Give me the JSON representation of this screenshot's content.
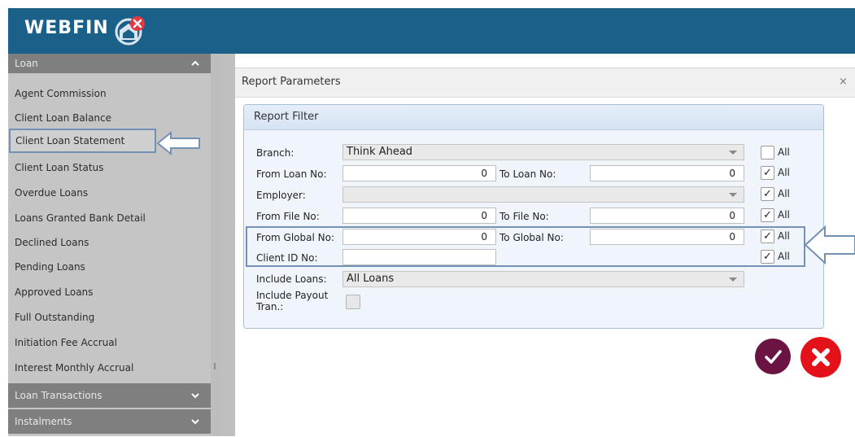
{
  "app": {
    "title": "WEBFIN",
    "logo_icon": "logo-icon"
  },
  "colors": {
    "header": "#1b6088",
    "sidebar": "#c5c5c5",
    "section": "#7f7f7f",
    "ok": "#6b1443",
    "cancel": "#e3111a"
  },
  "sidebar": {
    "loan_section": "Loan",
    "items": [
      {
        "label": "Agent Commission"
      },
      {
        "label": "Client Loan Balance"
      },
      {
        "label": "Client Loan Statement"
      },
      {
        "label": "Client Loan Status"
      },
      {
        "label": "Overdue Loans"
      },
      {
        "label": "Loans Granted Bank Detail"
      },
      {
        "label": "Declined Loans"
      },
      {
        "label": "Pending Loans"
      },
      {
        "label": "Approved Loans"
      },
      {
        "label": "Full Outstanding"
      },
      {
        "label": "Initiation Fee Accrual"
      },
      {
        "label": "Interest Monthly Accrual"
      }
    ],
    "transactions_section": "Loan Transactions",
    "instalments_section": "Instalments"
  },
  "dialog": {
    "title": "Report Parameters",
    "close": "×",
    "filter": {
      "title": "Report Filter",
      "branch_label": "Branch:",
      "branch_value": "Think Ahead",
      "from_loan_label": "From Loan No:",
      "from_loan_value": "0",
      "to_loan_label": "To Loan No:",
      "to_loan_value": "0",
      "employer_label": "Employer:",
      "employer_value": "",
      "from_file_label": "From File No:",
      "from_file_value": "0",
      "to_file_label": "To File No:",
      "to_file_value": "0",
      "from_global_label": "From Global No:",
      "from_global_value": "0",
      "to_global_label": "To Global No:",
      "to_global_value": "0",
      "client_id_label": "Client ID No:",
      "client_id_value": "",
      "include_loans_label": "Include Loans:",
      "include_loans_value": "All Loans",
      "include_payout_label_1": "Include Payout",
      "include_payout_label_2": "Tran.:",
      "all_label": "All",
      "check_mark": "✓"
    }
  }
}
